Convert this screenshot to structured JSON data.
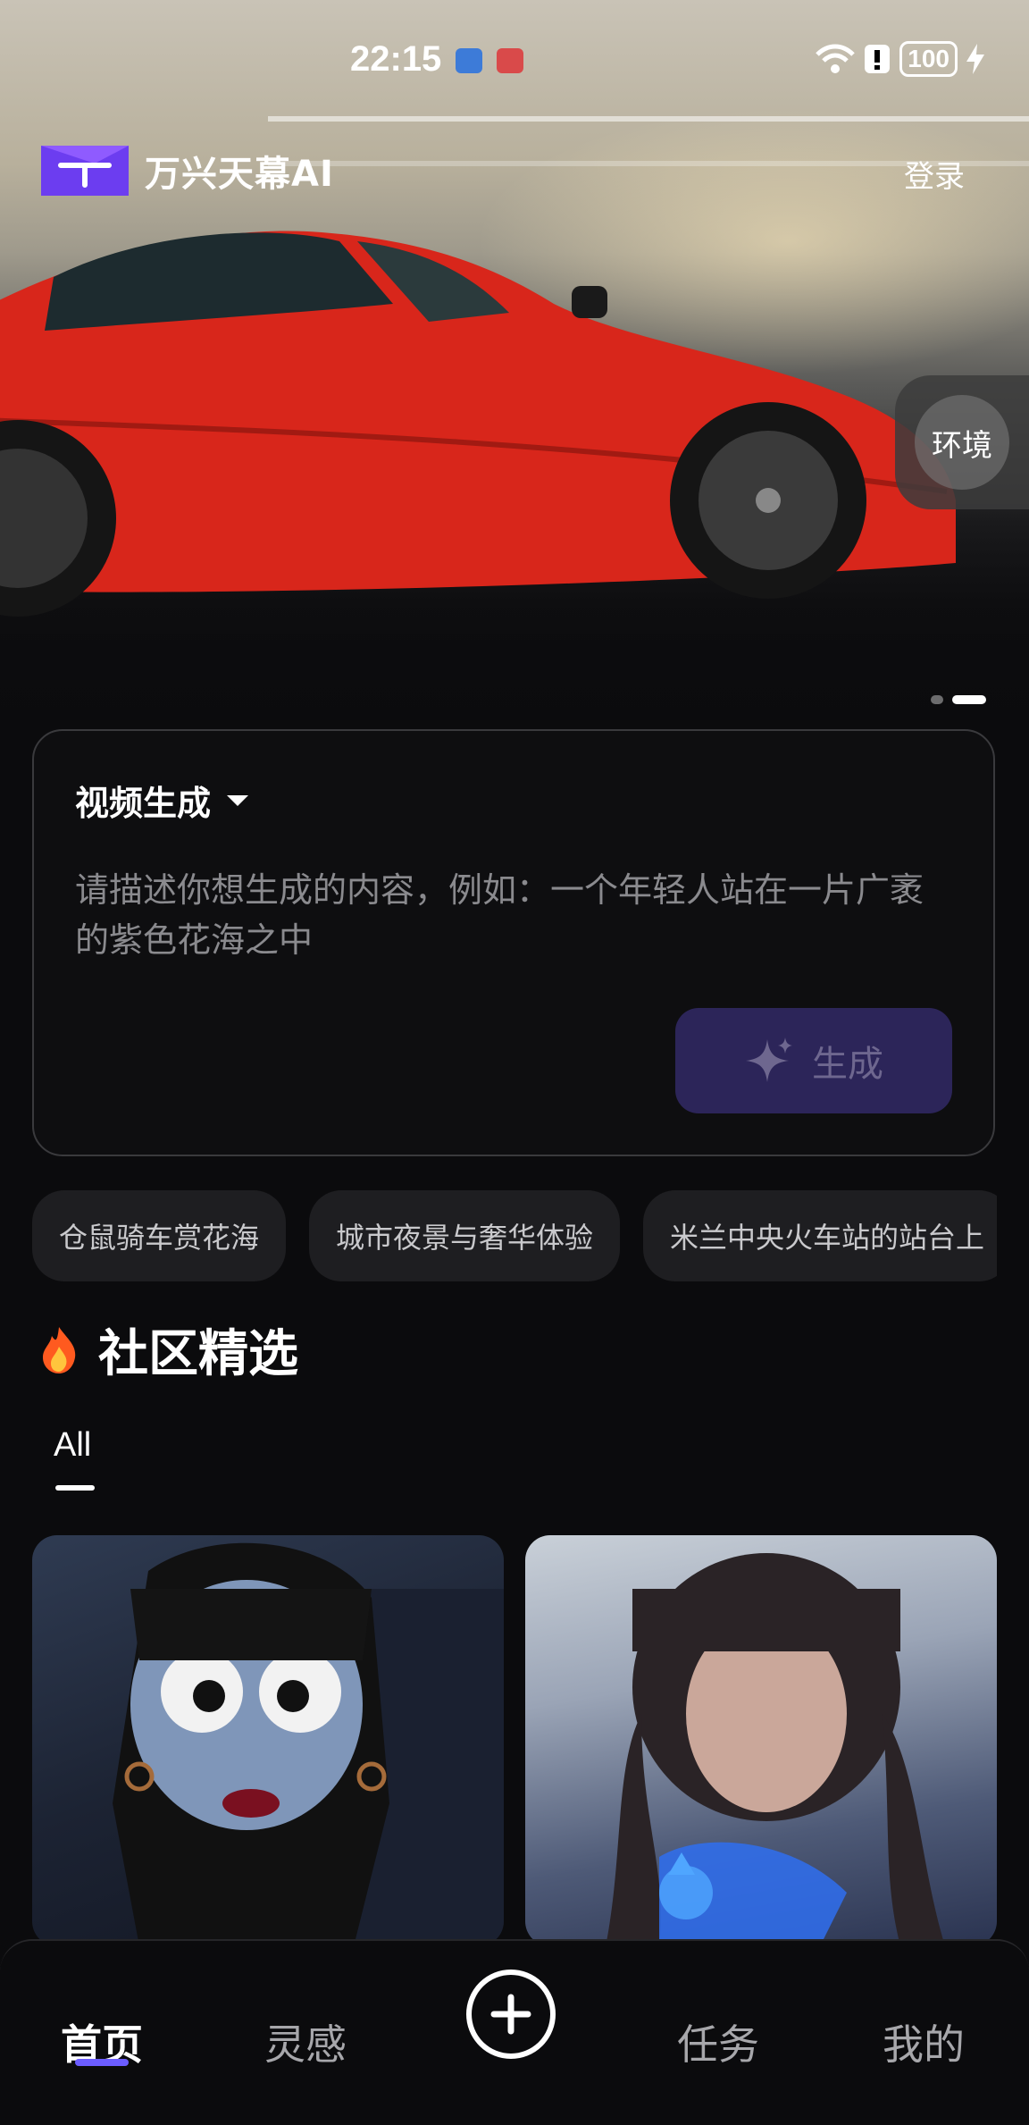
{
  "status_bar": {
    "time": "22:15",
    "battery": "100"
  },
  "app": {
    "title": "万兴天幕AI",
    "login_label": "登录"
  },
  "hero": {
    "env_button_label": "环境"
  },
  "prompt": {
    "mode_label": "视频生成",
    "placeholder": "请描述你想生成的内容，例如：一个年轻人站在一片广袤的紫色花海之中",
    "generate_label": "生成"
  },
  "chips": [
    "仓鼠骑车赏花海",
    "城市夜景与奢华体验",
    "米兰中央火车站的站台上"
  ],
  "section": {
    "title": "社区精选",
    "tabs": [
      "All"
    ]
  },
  "nav": {
    "items": [
      "首页",
      "灵感",
      "任务",
      "我的"
    ]
  },
  "colors": {
    "accent": "#6b5cff",
    "generate_button_bg": "#2c2559",
    "background": "#0b0b0d"
  }
}
